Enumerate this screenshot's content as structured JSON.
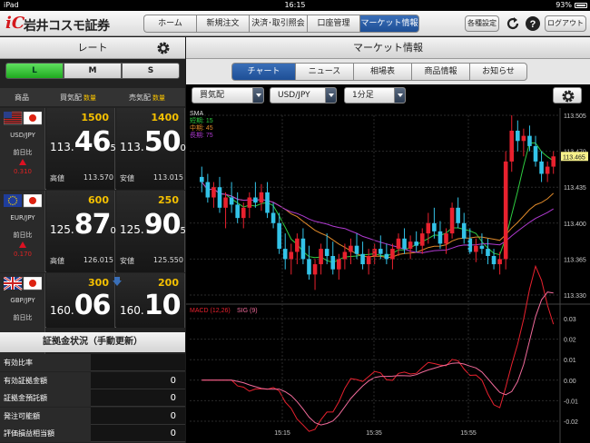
{
  "statusbar": {
    "carrier": "iPad",
    "time": "16:15",
    "battery": "93%"
  },
  "header": {
    "logo_text": "岩井コスモ証券",
    "nav": [
      {
        "label": "ホーム",
        "active": false,
        "w": 58
      },
      {
        "label": "新規注文",
        "active": false,
        "w": 58
      },
      {
        "label": "決済･取引照会",
        "active": false,
        "w": 64
      },
      {
        "label": "口座管理",
        "active": false,
        "w": 58
      },
      {
        "label": "マーケット情報",
        "active": true,
        "w": 66
      }
    ],
    "settings_label": "各種設定",
    "logout_label": "ログアウト"
  },
  "rate_panel": {
    "title": "レート",
    "lot_tabs": [
      {
        "label": "L",
        "active": true
      },
      {
        "label": "M",
        "active": false
      },
      {
        "label": "S",
        "active": false
      }
    ],
    "columns": {
      "pair": "商品",
      "bid": "買気配",
      "ask": "売気配",
      "amount": "数量"
    },
    "pairs": [
      {
        "name": "USD/JPY",
        "flags": [
          "us",
          "jp"
        ],
        "prev_label": "前日比",
        "change": "0.310",
        "bid": {
          "amount": "1500",
          "small": "113.",
          "big": "46",
          "tail": "5",
          "hl_label": "高値",
          "hl_value": "113.570"
        },
        "ask": {
          "amount": "1400",
          "small": "113.",
          "big": "50",
          "tail": "0",
          "hl_label": "安値",
          "hl_value": "113.015"
        }
      },
      {
        "name": "EUR/JPY",
        "flags": [
          "eu",
          "jp"
        ],
        "prev_label": "前日比",
        "change": "0.170",
        "bid": {
          "amount": "600",
          "small": "125.",
          "big": "87",
          "tail": "0",
          "hl_label": "高値",
          "hl_value": "126.015"
        },
        "ask": {
          "amount": "250",
          "small": "125.",
          "big": "90",
          "tail": "5",
          "hl_label": "安値",
          "hl_value": "125.550"
        }
      },
      {
        "name": "GBP/JPY",
        "flags": [
          "gb",
          "jp"
        ],
        "prev_label": "前日比",
        "change": "",
        "bid": {
          "amount": "300",
          "small": "160.",
          "big": "06",
          "tail": "",
          "hl_label": "",
          "hl_value": ""
        },
        "ask": {
          "amount": "200",
          "small": "160.",
          "big": "10",
          "tail": "",
          "hl_label": "",
          "hl_value": ""
        }
      }
    ]
  },
  "margin": {
    "title": "証拠金状況（手動更新）",
    "rows": [
      {
        "label": "有効比率",
        "value": ""
      },
      {
        "label": "有効証拠金額",
        "value": "0"
      },
      {
        "label": "証拠金預託額",
        "value": "0"
      },
      {
        "label": "発注可能額",
        "value": "0"
      },
      {
        "label": "評価損益相当額",
        "value": "0"
      }
    ]
  },
  "market": {
    "title": "マーケット情報",
    "tabs": [
      {
        "label": "チャート",
        "active": true
      },
      {
        "label": "ニュース",
        "active": false
      },
      {
        "label": "相場表",
        "active": false
      },
      {
        "label": "商品情報",
        "active": false
      },
      {
        "label": "お知らせ",
        "active": false
      }
    ],
    "side_select": "買気配",
    "pair_select": "USD/JPY",
    "interval_select": "1分足"
  },
  "chart_data": {
    "type": "candlestick",
    "indicator_label": "SMA",
    "sma_legend": [
      {
        "name": "短期: 15",
        "color": "#2ecc40"
      },
      {
        "name": "中期: 45",
        "color": "#e08a2a"
      },
      {
        "name": "長期: 75",
        "color": "#b03ad0"
      }
    ],
    "y_ticks": [
      "113.505",
      "113.470",
      "113.435",
      "113.400",
      "113.365",
      "113.330"
    ],
    "ylim": [
      113.33,
      113.505
    ],
    "current_price": "113.465",
    "x_ticks": [
      "15:15",
      "15:35",
      "15:55"
    ],
    "macd_label": "MACD (12,26)",
    "sig_label": "SIG (9)",
    "macd_ticks": [
      "0.03",
      "0.02",
      "0.01",
      "0.00",
      "-0.01",
      "-0.02"
    ],
    "candles": [
      [
        113.445,
        113.455,
        113.43,
        113.44
      ],
      [
        113.44,
        113.448,
        113.42,
        113.425
      ],
      [
        113.425,
        113.44,
        113.415,
        113.435
      ],
      [
        113.435,
        113.445,
        113.41,
        113.415
      ],
      [
        113.415,
        113.43,
        113.395,
        113.425
      ],
      [
        113.425,
        113.44,
        113.41,
        113.418
      ],
      [
        113.418,
        113.43,
        113.4,
        113.405
      ],
      [
        113.405,
        113.42,
        113.395,
        113.415
      ],
      [
        113.415,
        113.43,
        113.405,
        113.425
      ],
      [
        113.425,
        113.44,
        113.415,
        113.42
      ],
      [
        113.42,
        113.438,
        113.412,
        113.43
      ],
      [
        113.43,
        113.44,
        113.405,
        113.41
      ],
      [
        113.41,
        113.42,
        113.395,
        113.4
      ],
      [
        113.4,
        113.41,
        113.37,
        113.375
      ],
      [
        113.375,
        113.39,
        113.355,
        113.365
      ],
      [
        113.365,
        113.38,
        113.35,
        113.372
      ],
      [
        113.372,
        113.39,
        113.36,
        113.385
      ],
      [
        113.385,
        113.395,
        113.36,
        113.365
      ],
      [
        113.365,
        113.378,
        113.345,
        113.35
      ],
      [
        113.35,
        113.365,
        113.335,
        113.36
      ],
      [
        113.36,
        113.38,
        113.35,
        113.375
      ],
      [
        113.375,
        113.39,
        113.36,
        113.368
      ],
      [
        113.368,
        113.382,
        113.35,
        113.355
      ],
      [
        113.355,
        113.37,
        113.345,
        113.365
      ],
      [
        113.365,
        113.38,
        113.355,
        113.372
      ],
      [
        113.372,
        113.385,
        113.36,
        113.378
      ],
      [
        113.378,
        113.39,
        113.365,
        113.37
      ],
      [
        113.37,
        113.382,
        113.355,
        113.36
      ],
      [
        113.36,
        113.375,
        113.35,
        113.368
      ],
      [
        113.368,
        113.38,
        113.36,
        113.375
      ],
      [
        113.375,
        113.388,
        113.365,
        113.37
      ],
      [
        113.37,
        113.38,
        113.36,
        113.365
      ],
      [
        113.365,
        113.38,
        113.355,
        113.375
      ],
      [
        113.375,
        113.39,
        113.368,
        113.385
      ],
      [
        113.385,
        113.395,
        113.37,
        113.375
      ],
      [
        113.375,
        113.388,
        113.365,
        113.382
      ],
      [
        113.382,
        113.392,
        113.372,
        113.378
      ],
      [
        113.378,
        113.395,
        113.37,
        113.39
      ],
      [
        113.39,
        113.41,
        113.38,
        113.4
      ],
      [
        113.4,
        113.415,
        113.385,
        113.392
      ],
      [
        113.392,
        113.402,
        113.375,
        113.38
      ],
      [
        113.38,
        113.395,
        113.37,
        113.39
      ],
      [
        113.39,
        113.42,
        113.385,
        113.415
      ],
      [
        113.415,
        113.425,
        113.395,
        113.4
      ],
      [
        113.4,
        113.41,
        113.38,
        113.385
      ],
      [
        113.385,
        113.395,
        113.37,
        113.372
      ],
      [
        113.372,
        113.385,
        113.362,
        113.378
      ],
      [
        113.378,
        113.39,
        113.37,
        113.375
      ],
      [
        113.375,
        113.385,
        113.36,
        113.368
      ],
      [
        113.368,
        113.375,
        113.355,
        113.36
      ],
      [
        113.36,
        113.372,
        113.35,
        113.365
      ],
      [
        113.365,
        113.47,
        113.355,
        113.46
      ],
      [
        113.46,
        113.505,
        113.45,
        113.49
      ],
      [
        113.49,
        113.5,
        113.47,
        113.48
      ],
      [
        113.48,
        113.492,
        113.465,
        113.485
      ],
      [
        113.485,
        113.495,
        113.47,
        113.475
      ],
      [
        113.475,
        113.485,
        113.455,
        113.46
      ],
      [
        113.46,
        113.47,
        113.44,
        113.448
      ],
      [
        113.448,
        113.46,
        113.44,
        113.455
      ],
      [
        113.455,
        113.47,
        113.448,
        113.465
      ]
    ]
  }
}
